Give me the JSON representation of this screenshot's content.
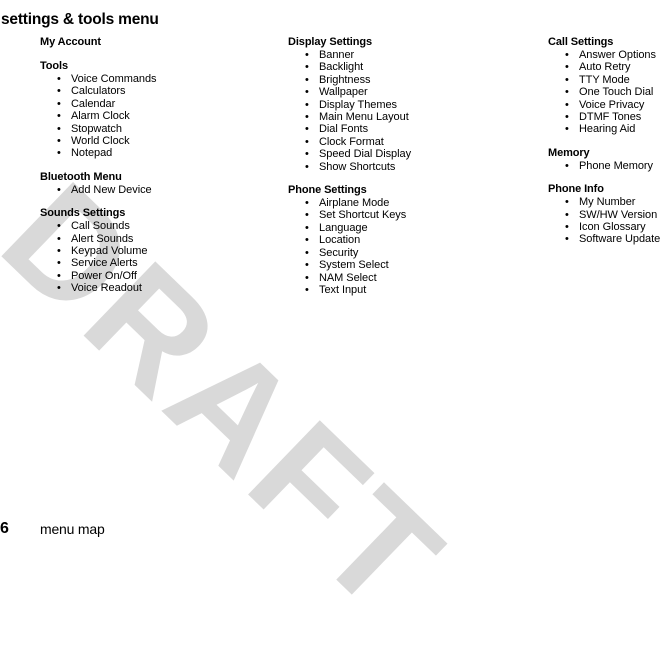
{
  "page": {
    "title": "settings & tools menu",
    "watermark": "DRAFT",
    "watermark_color": "#d9d9d9",
    "number": "6",
    "footer_label": "menu map",
    "bullet_glyph": "•"
  },
  "columns": [
    {
      "id": "column-1",
      "sections": [
        {
          "title": "My Account",
          "items": []
        },
        {
          "title": "Tools",
          "items": [
            "Voice Commands",
            "Calculators",
            "Calendar",
            "Alarm Clock",
            "Stopwatch",
            "World Clock",
            "Notepad"
          ]
        },
        {
          "title": "Bluetooth Menu",
          "items": [
            "Add New Device"
          ]
        },
        {
          "title": "Sounds Settings",
          "items": [
            "Call Sounds",
            "Alert Sounds",
            "Keypad Volume",
            "Service Alerts",
            "Power On/Off",
            "Voice Readout"
          ]
        }
      ]
    },
    {
      "id": "column-2",
      "sections": [
        {
          "title": "Display Settings",
          "items": [
            "Banner",
            "Backlight",
            "Brightness",
            "Wallpaper",
            "Display Themes",
            "Main Menu Layout",
            "Dial Fonts",
            "Clock Format",
            "Speed Dial Display",
            "Show Shortcuts"
          ]
        },
        {
          "title": "Phone Settings",
          "items": [
            "Airplane Mode",
            "Set Shortcut Keys",
            "Language",
            "Location",
            "Security",
            "System Select",
            "NAM Select",
            "Text Input"
          ]
        }
      ]
    },
    {
      "id": "column-3",
      "sections": [
        {
          "title": "Call Settings",
          "items": [
            "Answer Options",
            "Auto Retry",
            "TTY Mode",
            "One Touch Dial",
            "Voice Privacy",
            "DTMF Tones",
            "Hearing Aid"
          ]
        },
        {
          "title": "Memory",
          "items": [
            "Phone Memory"
          ]
        },
        {
          "title": "Phone Info",
          "items": [
            "My Number",
            "SW/HW Version",
            "Icon Glossary",
            "Software Update"
          ]
        }
      ]
    }
  ]
}
